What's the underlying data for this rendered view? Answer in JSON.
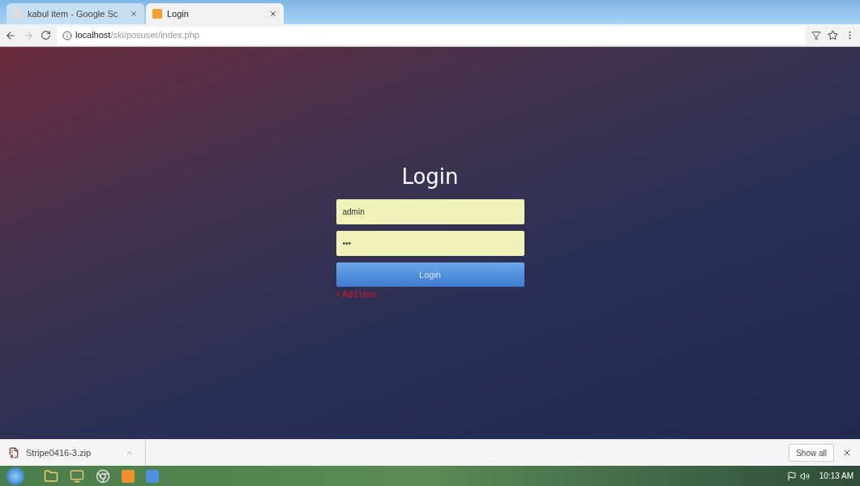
{
  "browser": {
    "tabs": [
      {
        "title": "kabul item - Google Sc",
        "selected": false
      },
      {
        "title": "Login",
        "selected": true
      }
    ],
    "url_host": "localhost",
    "url_path": "/ski/posuser/index.php"
  },
  "login": {
    "title": "Login",
    "username": "admin",
    "password": "•••",
    "button": "Login",
    "link": "+ Add User"
  },
  "downloads": {
    "file": "Stripe0416-3.zip",
    "show_all": "Show all"
  },
  "taskbar": {
    "clock": "10:13 AM"
  }
}
